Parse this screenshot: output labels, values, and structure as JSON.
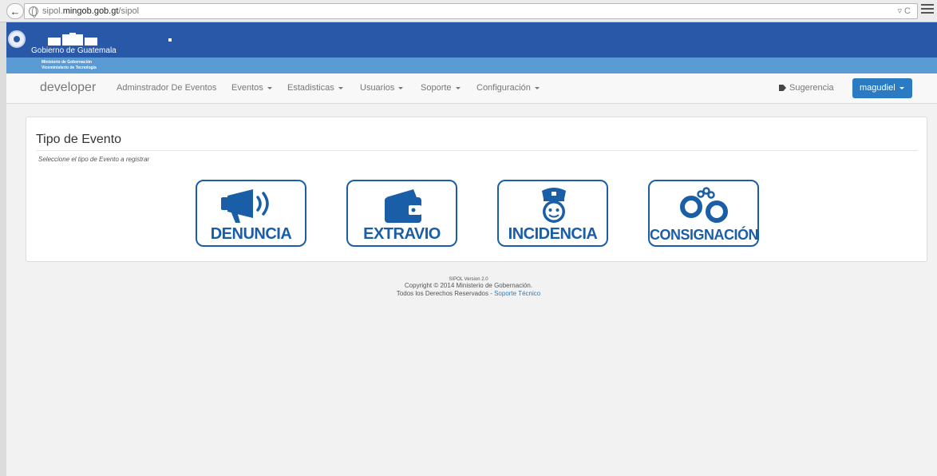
{
  "browser": {
    "url_domain": "sipol.mingob.gob.gt",
    "url_path": "/sipol",
    "url_prefix": "sipol."
  },
  "banner": {
    "gov_name": "Gobierno de Guatemala",
    "ministry": "Ministerio de Gobernación",
    "vice_ministry": "Viceministerio de Tecnología"
  },
  "navbar": {
    "brand": "developer",
    "items": [
      {
        "label": "Adminstrador De Eventos",
        "dropdown": false
      },
      {
        "label": "Eventos",
        "dropdown": true
      },
      {
        "label": "Estadisticas",
        "dropdown": true
      },
      {
        "label": "Usuarios",
        "dropdown": true
      },
      {
        "label": "Soporte",
        "dropdown": true
      },
      {
        "label": "Configuración",
        "dropdown": true
      }
    ],
    "suggestion": "Sugerencia",
    "user": "magudiel"
  },
  "panel": {
    "title": "Tipo de Evento",
    "subtitle": "Seleccione el tipo de Evento a registrar",
    "events": [
      {
        "label": "DENUNCIA",
        "icon": "megaphone-icon"
      },
      {
        "label": "EXTRAVIO",
        "icon": "wallet-icon"
      },
      {
        "label": "INCIDENCIA",
        "icon": "police-officer-icon"
      },
      {
        "label": "CONSIGNACIÓN",
        "icon": "handcuffs-icon"
      }
    ]
  },
  "footer": {
    "version": "SIPOL Version 2.0",
    "copyright": "Copyright © 2014 Ministerio de Gobernación.",
    "rights": "Todos los Derechos Reservados - ",
    "support_link": "Soporte Técnico"
  },
  "colors": {
    "banner": "#2a58a8",
    "accent": "#1a5ea8",
    "button": "#2b7bc2"
  }
}
